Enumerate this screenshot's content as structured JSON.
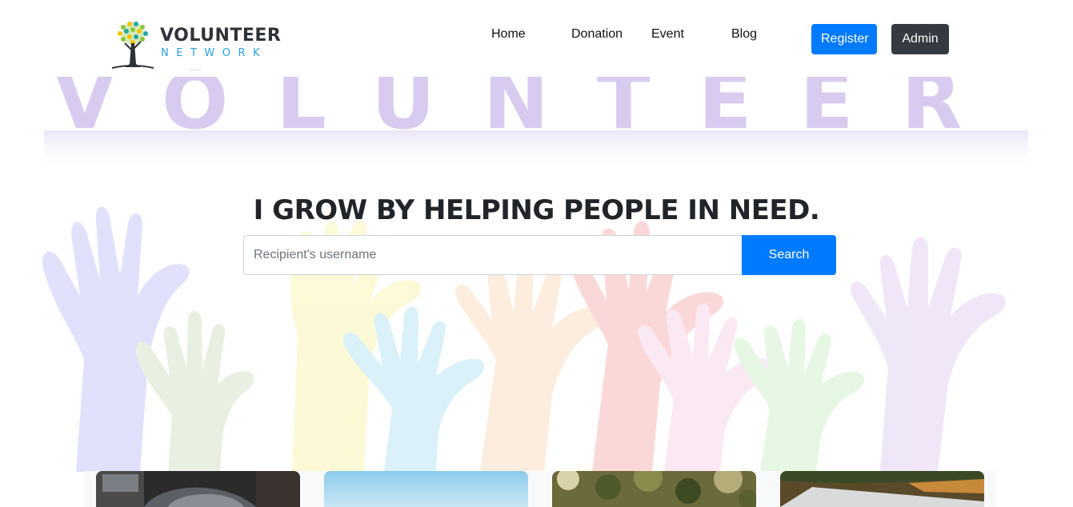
{
  "brand": {
    "title": "VOLUNTEER",
    "subtitle": "NETWORK",
    "icon": "tree-logo-icon"
  },
  "nav": {
    "links": [
      "Home",
      "Donation",
      "Event",
      "Blog"
    ],
    "register_label": "Register",
    "admin_label": "Admin"
  },
  "hero": {
    "background_word": "VOLUNTEER",
    "headline": "I GROW BY HELPING PEOPLE IN NEED.",
    "search": {
      "placeholder": "Recipient's username",
      "value": "",
      "button_label": "Search"
    }
  },
  "colors": {
    "primary": "#007bff",
    "dark": "#343a40"
  },
  "cards": [
    {
      "icon": "person-sweater-photo"
    },
    {
      "icon": "sky-photo"
    },
    {
      "icon": "tree-leaves-photo"
    },
    {
      "icon": "landscape-photo"
    }
  ]
}
